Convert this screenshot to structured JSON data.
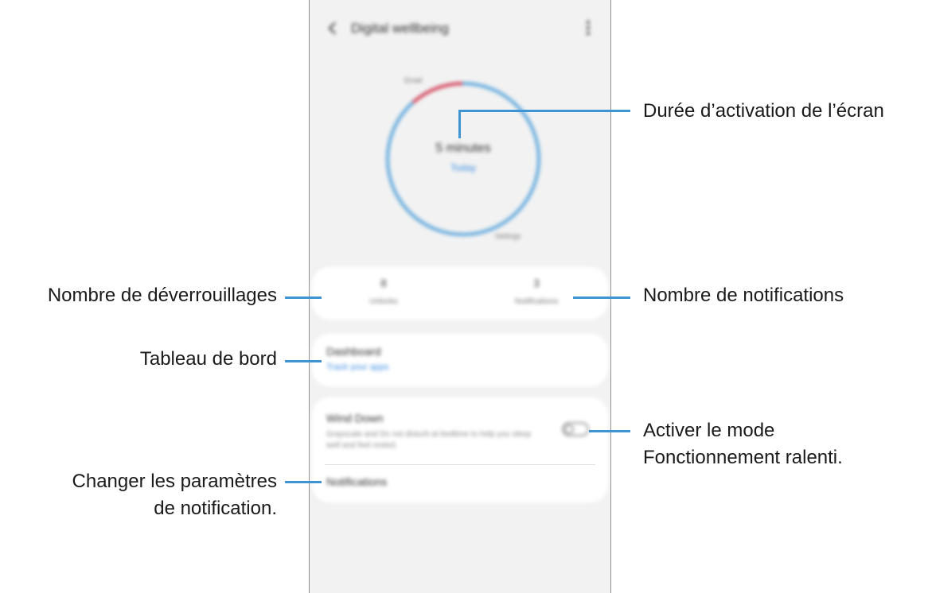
{
  "app": {
    "title": "Digital wellbeing",
    "back_icon": "chevron-left-icon",
    "more_icon": "more-vertical-icon"
  },
  "chart": {
    "total_time": "5 minutes",
    "subtitle": "Today",
    "top_label": "Email",
    "bottom_label": "Settings",
    "colors": {
      "ring": "#5fa8dc",
      "segment": "#d9445a"
    }
  },
  "stats": {
    "unlocks_value": "8",
    "unlocks_label": "Unlocks",
    "notifications_value": "3",
    "notifications_label": "Notifications"
  },
  "dashboard": {
    "title": "Dashboard",
    "link": "Track your apps"
  },
  "wind_down": {
    "title": "Wind Down",
    "description": "Grayscale and Do not disturb at bedtime to help you sleep well and feel rested.",
    "toggle_on": false
  },
  "notifications_row": {
    "title": "Notifications"
  },
  "callouts": {
    "screen_time": "Durée d’activation de l’écran",
    "unlocks": "Nombre de déverrouillages",
    "notifications": "Nombre de notifications",
    "dashboard": "Tableau de bord",
    "wind_down_line1": "Activer le mode",
    "wind_down_line2": "Fonctionnement ralenti.",
    "notif_settings_line1": "Changer les paramètres",
    "notif_settings_line2": "de notification."
  },
  "accent_color": "#3f95d4"
}
